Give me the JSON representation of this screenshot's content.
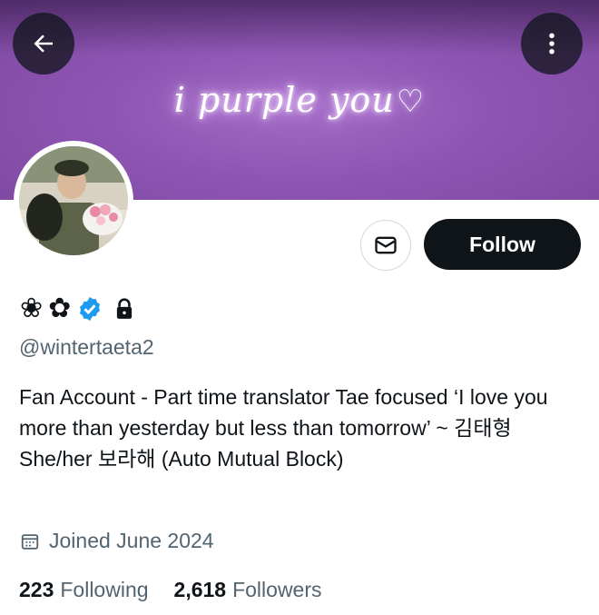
{
  "banner": {
    "text": "i purple you",
    "heart": "♡"
  },
  "nav": {
    "back_icon": "arrow-left-icon",
    "more_icon": "more-vertical-icon"
  },
  "actions": {
    "message_icon": "envelope-icon",
    "follow_label": "Follow"
  },
  "profile": {
    "name_glyphs": [
      "❀",
      "✿"
    ],
    "verified_color": "#1d9bf0",
    "handle": "@wintertaeta2",
    "bio": "Fan Account - Part time translator Tae focused ‘I love you more than yesterday but less than tomorrow’ ~ 김태형 She/her 보라해 (Auto Mutual Block)",
    "joined": "Joined June 2024"
  },
  "stats": {
    "following_count": "223",
    "following_label": "Following",
    "followers_count": "2,618",
    "followers_label": "Followers"
  },
  "colors": {
    "banner_purple": "#8e56b3",
    "text_primary": "#0f1419",
    "text_secondary": "#536471"
  }
}
